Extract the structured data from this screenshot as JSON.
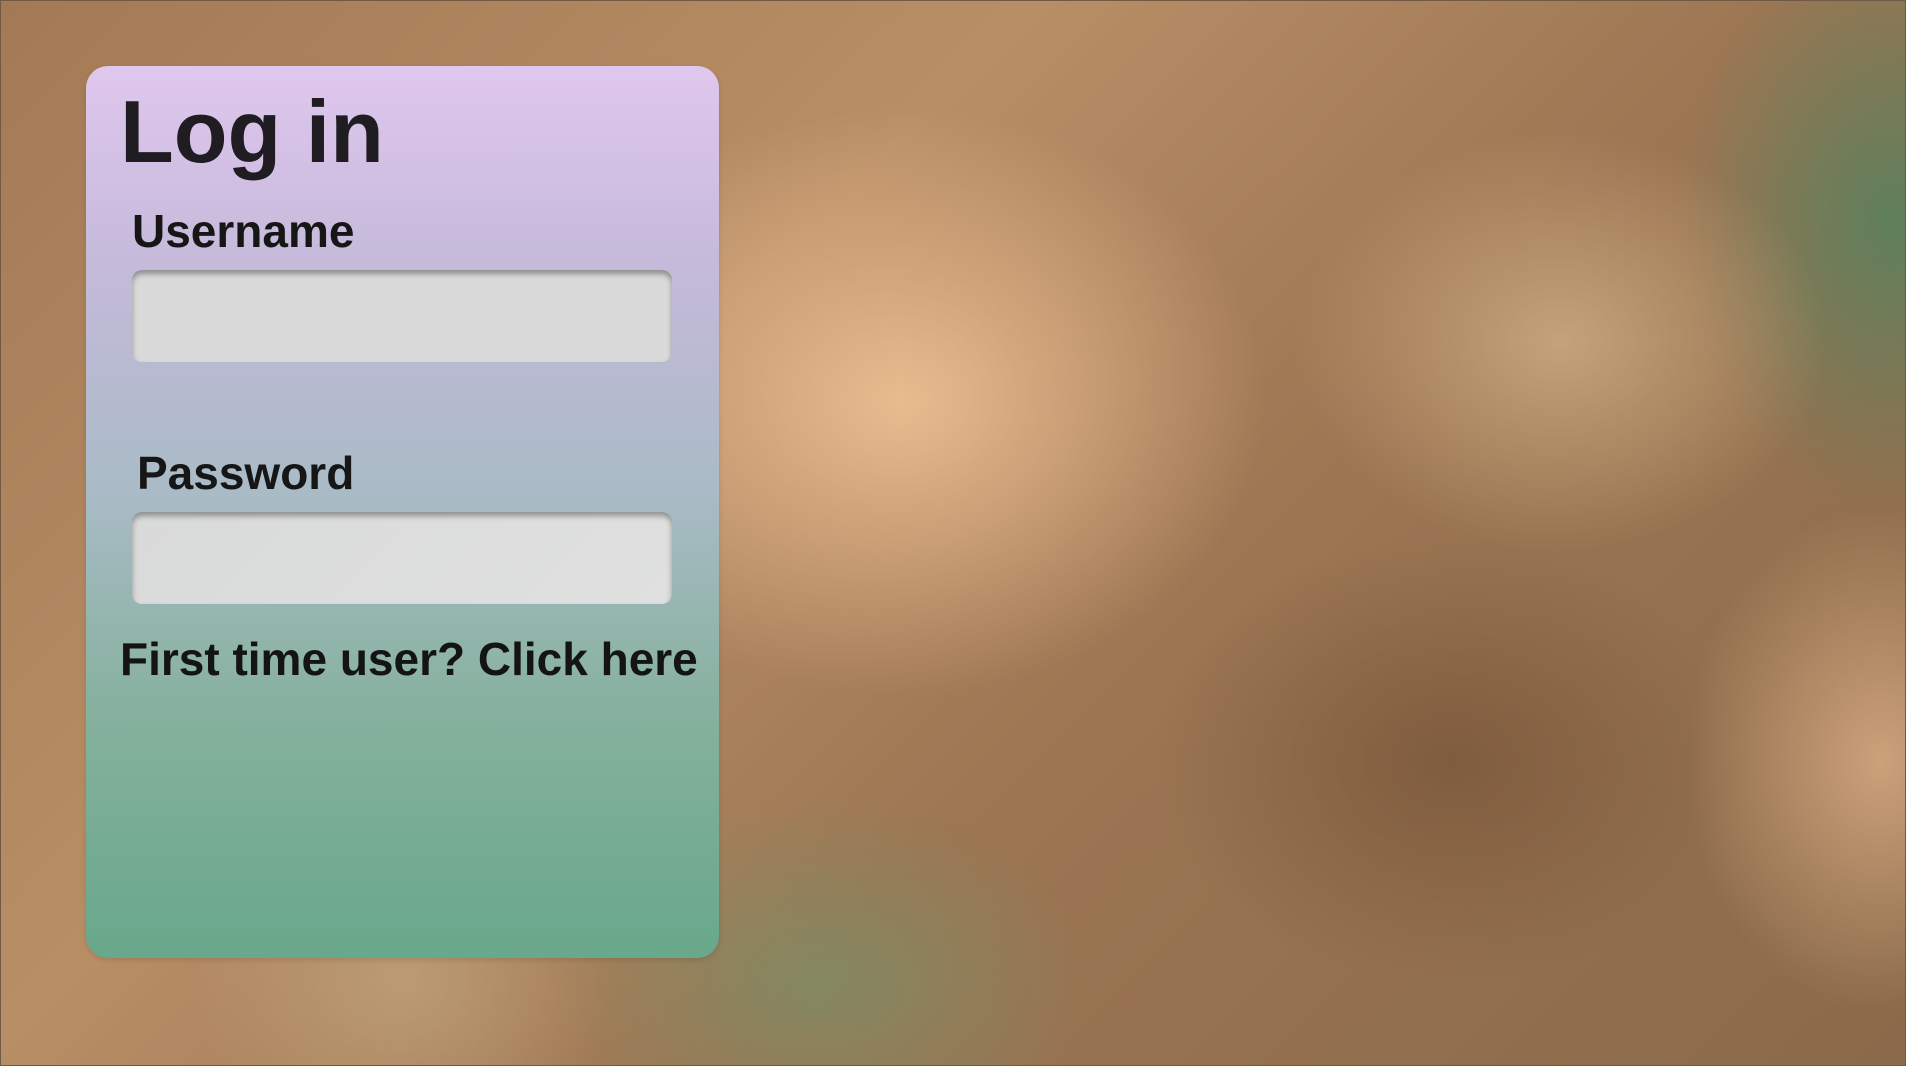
{
  "page": {
    "colors": {
      "card_gradient_top": "#e0c7ee",
      "card_gradient_bottom": "#68a88b",
      "input_background": "#dadada",
      "text": "#161616"
    }
  },
  "login_form": {
    "title": "Log in",
    "username": {
      "label": "Username",
      "value": "",
      "placeholder": ""
    },
    "password": {
      "label": "Password",
      "value": "",
      "placeholder": ""
    },
    "first_time_link": "First time user? Click here"
  }
}
